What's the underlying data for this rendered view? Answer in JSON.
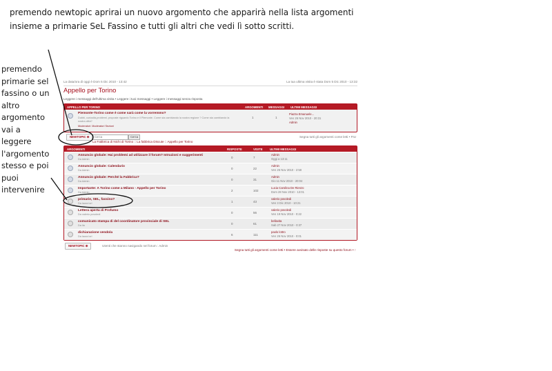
{
  "annotation": {
    "top_text": "premendo newtopic aprirai un nuovo argomento che apparirà nella lista argomenti insieme a primarie SeL Fassino e tutti gli altri che vedi lì sotto scritti.",
    "left_text": "premendo primarie sel fassino o un altro argomento vai a leggere l'argomento stesso e poi puoi intervenire"
  },
  "forum": {
    "date_now": "La data/ora di oggi è Dom 5 Dic 2010 - 13:42",
    "last_visit": "La tua ultima visita è stata Dom 5 Dic 2010 - 13:32",
    "title": "Appello per Torino",
    "nav_links": "Leggere i messaggi dell'ultima visita • Leggere i tuoi messaggi • Leggere i messaggi senza risposta",
    "section": {
      "header_name": "APPELLO PER TORINO",
      "header_topics": "ARGOMENTI",
      "header_posts": "MESSAGGI",
      "header_last": "ULTIMI MESSAGGI",
      "subforum_title": "Piemonte-Torino come è come sarà come la vorremmo?",
      "subforum_desc": "Dubbi, curiosità,problemi, proposte riguardo Torino e il Piemonte. Come sta cambiando la nostra regione ? Come sta cambiando la nostra città?",
      "moderators": "Moderatori: Moderatori Sezioni",
      "topics": "1",
      "posts": "1",
      "last_title": "Piazza Emanuele...",
      "last_date": "Ven 26 Nov 2010 - 20:31",
      "last_author": "Admin"
    },
    "toolbar": {
      "newtopic": "NEWTOPIC ⊕",
      "search_placeholder": "Cerca",
      "search_button": "Cerca",
      "mark_read": "Segna tutti gli argomenti come letti • FIU"
    },
    "breadcrumb": "La Fabbrica di Nichi di Torino :: La fabbrica Discute :: Appello per Torino",
    "topics_header": {
      "name": "ARGOMENTI",
      "replies": "RISPOSTE",
      "views": "VISITE",
      "last": "ULTIMI MESSAGGI"
    },
    "topics": [
      {
        "prefix": "Annuncio globale:",
        "title": "Hai problemi ad utilizzare il forum? Istruzioni e suggerimenti",
        "author": "Da Admin",
        "replies": "0",
        "views": "7",
        "last_author": "Admin",
        "last_date": "Oggi a 13:11"
      },
      {
        "prefix": "Annuncio globale:",
        "title": "Calendario",
        "author": "Da Admin",
        "replies": "0",
        "views": "22",
        "last_author": "Admin",
        "last_date": "Ven 26 Nov 2010 - 2:58"
      },
      {
        "prefix": "Annuncio globale:",
        "title": "Perché la Fabbrica?",
        "author": "Da Admin",
        "replies": "0",
        "views": "31",
        "last_author": "Admin",
        "last_date": "Gio 11 Nov 2010 - 20:04"
      },
      {
        "prefix": "Importante:",
        "title": "A Torino come a Milano - Appello per Torino",
        "author": "Da Admin",
        "replies": "2",
        "views": "102",
        "last_author": "Lucia Carolina De Rienzo",
        "last_date": "Dom 28 Nov 2010 - 13:01"
      },
      {
        "prefix": "",
        "title": "primarie, SEL, fassino?",
        "author": "Da laura lori",
        "replies": "1",
        "views": "43",
        "last_author": "valerio povoledi",
        "last_date": "Ven 3 Dic 2010 - 10:21"
      },
      {
        "prefix": "",
        "title": "Lettera aperta di Profumo",
        "author": "Da valerio povoledi",
        "replies": "0",
        "views": "56",
        "last_author": "valerio povoledi",
        "last_date": "Ven 19 Nov 2010 - 0:22"
      },
      {
        "prefix": "",
        "title": "comunicato stampa di del coordinatore provinciale di SEL",
        "author": "Da lia",
        "replies": "0",
        "views": "61",
        "last_author": "bellavita",
        "last_date": "Sab 27 Nov 2010 - 0:37"
      },
      {
        "prefix": "",
        "title": "dichiarazione vendola",
        "author": "Da laura lori",
        "replies": "6",
        "views": "111",
        "last_author": "paolo lottro",
        "last_date": "Ven 26 Nov 2010 - 0:01"
      }
    ],
    "footer": {
      "newtopic": "NEWTOPIC ⊕",
      "users": "Utenti che stanno navigando nel forum : Admin",
      "mark_read": "Segna tutti gli argomenti come letti • Essere avvisato delle risposte su questo forum • ↑"
    },
    "colors": {
      "accent": "#b51a25",
      "link": "#8c0b16"
    }
  }
}
